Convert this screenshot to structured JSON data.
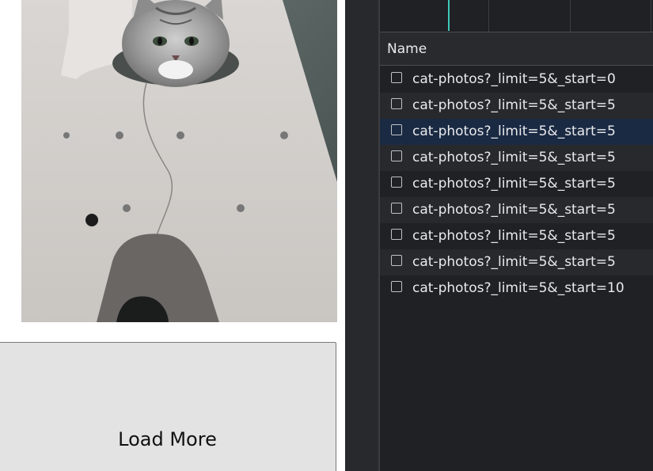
{
  "page": {
    "load_more_label": "Load More"
  },
  "devtools": {
    "column_header": "Name",
    "requests": [
      {
        "name": "cat-photos?_limit=5&_start=0",
        "selected": false
      },
      {
        "name": "cat-photos?_limit=5&_start=5",
        "selected": false
      },
      {
        "name": "cat-photos?_limit=5&_start=5",
        "selected": true
      },
      {
        "name": "cat-photos?_limit=5&_start=5",
        "selected": false
      },
      {
        "name": "cat-photos?_limit=5&_start=5",
        "selected": false
      },
      {
        "name": "cat-photos?_limit=5&_start=5",
        "selected": false
      },
      {
        "name": "cat-photos?_limit=5&_start=5",
        "selected": false
      },
      {
        "name": "cat-photos?_limit=5&_start=5",
        "selected": false
      },
      {
        "name": "cat-photos?_limit=5&_start=10",
        "selected": false
      }
    ]
  },
  "colors": {
    "devtools_bg": "#202124",
    "selected_row": "#1b2a43",
    "timeline_marker": "#3ec9b8",
    "button_bg": "#e3e3e3"
  }
}
